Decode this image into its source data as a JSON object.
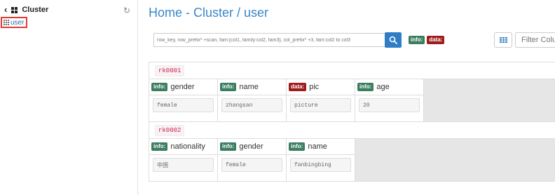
{
  "sidebar": {
    "title": "Cluster",
    "items": [
      {
        "label": "user"
      }
    ]
  },
  "header": {
    "title": "Home - Cluster / user"
  },
  "search": {
    "placeholder": "row_key, row_prefix* +scan, fam:{col1, family:col2, fam3}, col_prefix* +3, fam:col2 to col3"
  },
  "families": [
    {
      "label": "info:",
      "color": "#3a7d60"
    },
    {
      "label": "data:",
      "color": "#9e1c1c"
    }
  ],
  "filter": {
    "placeholder": "Filter Columns"
  },
  "rows": [
    {
      "key": "rk0001",
      "cells": [
        {
          "family": "info:",
          "qualifier": "gender",
          "value": "female"
        },
        {
          "family": "info:",
          "qualifier": "name",
          "value": "zhangsan"
        },
        {
          "family": "data:",
          "qualifier": "pic",
          "value": "picture"
        },
        {
          "family": "info:",
          "qualifier": "age",
          "value": "20"
        }
      ]
    },
    {
      "key": "rk0002",
      "cells": [
        {
          "family": "info:",
          "qualifier": "nationality",
          "value": "中国"
        },
        {
          "family": "info:",
          "qualifier": "gender",
          "value": "female"
        },
        {
          "family": "info:",
          "qualifier": "name",
          "value": "fanbingbing"
        }
      ]
    }
  ]
}
